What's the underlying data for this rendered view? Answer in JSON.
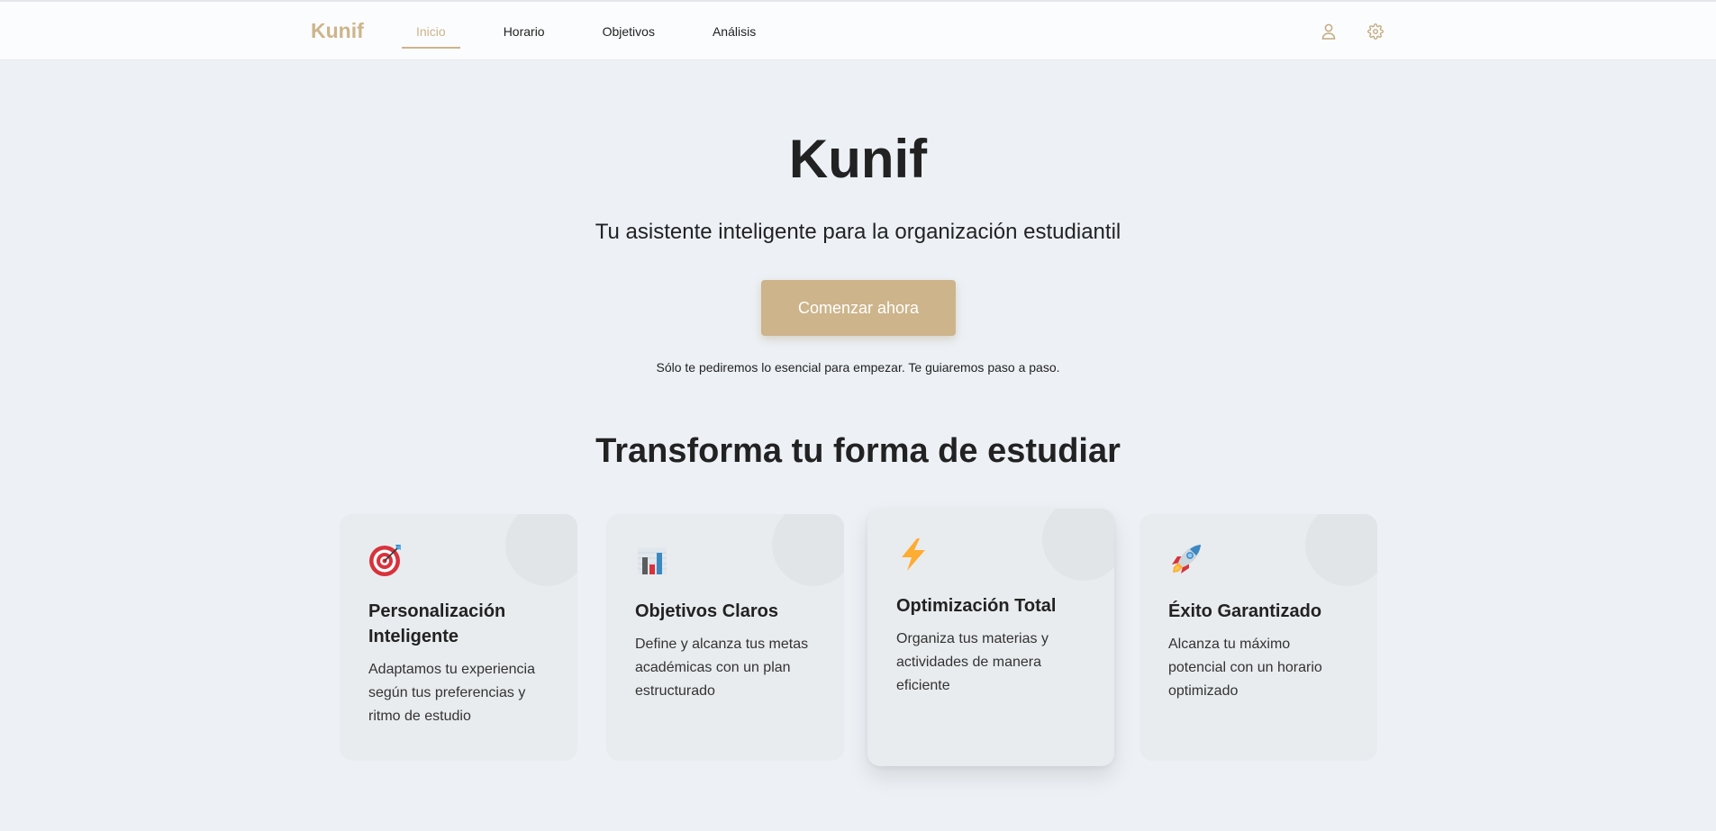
{
  "header": {
    "logo": "Kunif",
    "nav": [
      {
        "label": "Inicio",
        "active": true
      },
      {
        "label": "Horario",
        "active": false
      },
      {
        "label": "Objetivos",
        "active": false
      },
      {
        "label": "Análisis",
        "active": false
      }
    ],
    "icons": [
      "user-icon",
      "gear-icon"
    ]
  },
  "hero": {
    "title": "Kunif",
    "subtitle": "Tu asistente inteligente para la organización estudiantil",
    "cta_label": "Comenzar ahora",
    "hint": "Sólo te pediremos lo esencial para empezar. Te guiaremos paso a paso."
  },
  "features": {
    "title": "Transforma tu forma de estudiar",
    "cards": [
      {
        "icon": "target-icon",
        "title": "Personalización Inteligente",
        "description": "Adaptamos tu experiencia según tus preferencias y ritmo de estudio"
      },
      {
        "icon": "bar-chart-icon",
        "title": "Objetivos Claros",
        "description": "Define y alcanza tus metas académicas con un plan estructurado"
      },
      {
        "icon": "lightning-icon",
        "title": "Optimización Total",
        "description": "Organiza tus materias y actividades de manera eficiente"
      },
      {
        "icon": "rocket-icon",
        "title": "Éxito Garantizado",
        "description": "Alcanza tu máximo potencial con un horario optimizado"
      }
    ]
  },
  "colors": {
    "accent": "#cdb48b",
    "background": "#edf1f6",
    "card": "#e9ecef",
    "text": "#222222"
  }
}
